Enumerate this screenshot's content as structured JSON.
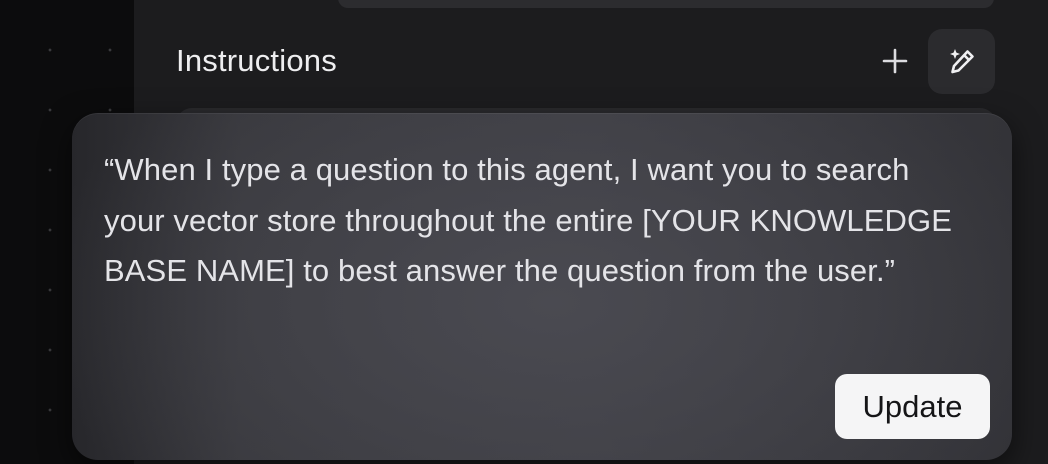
{
  "instructions": {
    "title": "Instructions",
    "add_icon": "plus-icon",
    "magic_icon": "magic-pencil-icon"
  },
  "popover": {
    "text": "“When I type a question to this agent, I want you to search your vector store throughout the entire [YOUR KNOWLEDGE BASE NAME] to best answer the question from the user.”",
    "update_label": "Update"
  },
  "colors": {
    "background": "#0d0d0e",
    "panel": "#1c1c1e",
    "popover": "#3d3d43",
    "button_bg": "#f5f5f6"
  }
}
